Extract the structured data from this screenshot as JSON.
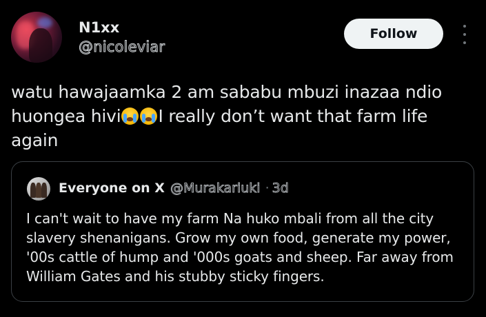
{
  "author": {
    "name": "N1xx",
    "handle": "@nicoleviar",
    "avatar_icon": "profile-photo"
  },
  "follow_label": "Follow",
  "more_icon": "more-options-vertical",
  "post": {
    "line1": "watu hawajaamka 2 am sababu mbuzi inazaa ndio",
    "line2_before": "huongea hivi",
    "emoji": "loudly-crying-face",
    "line2_after": "I really don’t want that farm life",
    "line3": "again"
  },
  "quote": {
    "name": "Everyone on X",
    "handle": "@Murakariuki",
    "separator": "·",
    "time": "3d",
    "text": "I can't wait to have my farm Na huko mbali from all the city slavery shenanigans. Grow my own food, generate my power, '00s cattle of hump and '000s goats and sheep. Far away from William Gates and his stubby sticky fingers."
  },
  "colors": {
    "background": "#000000",
    "text": "#e7e9ea",
    "muted": "#71767b",
    "button_bg": "#eff3f4",
    "border": "#3b4045"
  }
}
